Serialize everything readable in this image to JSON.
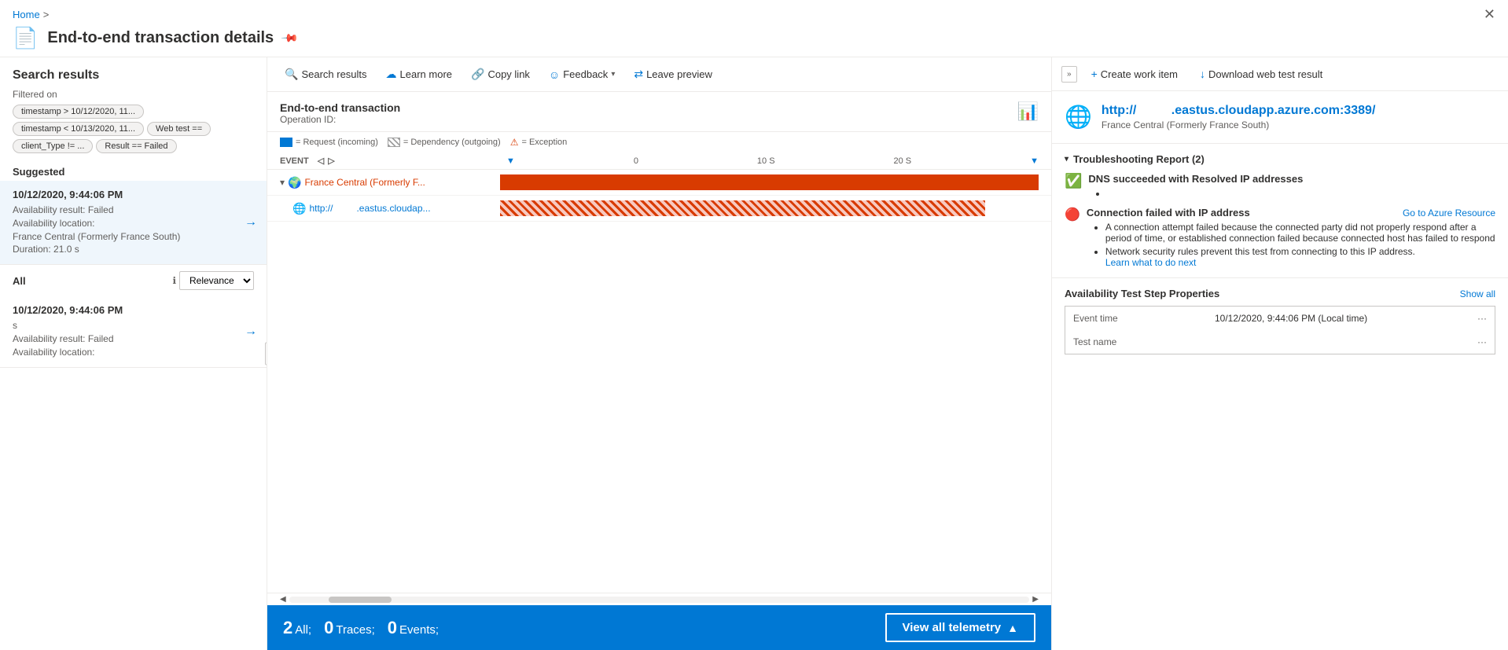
{
  "breadcrumb": {
    "home": "Home",
    "separator": ">"
  },
  "page": {
    "title": "End-to-end transaction details",
    "pin_label": "📌"
  },
  "left_panel": {
    "header": "Search results",
    "filter_label": "Filtered on",
    "filters": [
      "timestamp > 10/12/2020, 11...",
      "timestamp < 10/13/2020, 11...",
      "Web test ==",
      "client_Type !=  ...",
      "Result == Failed"
    ],
    "suggested_label": "Suggested",
    "results": [
      {
        "date": "10/12/2020, 9:44:06 PM",
        "details": "Availability result: Failed\nAvailability location:\nFrance Central (Formerly France South)\nDuration: 21.0 s",
        "selected": true
      }
    ],
    "sort_label": "All",
    "sort_options": [
      "Relevance"
    ],
    "sort_selected": "Relevance",
    "result2_date": "10/12/2020, 9:44:06 PM",
    "result2_detail": "s\nAvailability result: Failed\nAvailability location:"
  },
  "toolbar": {
    "search_results": "Search results",
    "learn_more": "Learn more",
    "copy_link": "Copy link",
    "feedback": "Feedback",
    "leave_preview": "Leave preview"
  },
  "transaction": {
    "title": "End-to-end transaction",
    "op_label": "Operation ID:",
    "legend": {
      "request_label": "= Request (incoming)",
      "dependency_label": "= Dependency (outgoing)",
      "exception_label": "= Exception"
    },
    "timeline": {
      "event_col": "EVENT",
      "time_markers": [
        "0",
        "10 S",
        "20 S"
      ],
      "rows": [
        {
          "name": "France Central (Formerly F...",
          "type": "solid",
          "bar_left": "0%",
          "bar_width": "100%",
          "icon": "🌍"
        },
        {
          "name": "http://                .eastus.cloudap...",
          "type": "hatched",
          "bar_left": "0%",
          "bar_width": "90%",
          "icon": "🌐"
        }
      ]
    },
    "footer": {
      "all_label": "All;",
      "all_count": "2",
      "traces_label": "Traces;",
      "traces_count": "0",
      "events_label": "Events;",
      "events_count": "0",
      "view_all": "View all telemetry"
    }
  },
  "right_panel": {
    "create_work_item": "Create work item",
    "download_web_test": "Download web test result",
    "resource": {
      "url_prefix": "http://",
      "url_suffix": ".eastus.cloudapp.azure.com:3389/",
      "location": "France Central (Formerly France South)"
    },
    "troubleshooting": {
      "title": "Troubleshooting Report (2)",
      "items": [
        {
          "status": "success",
          "title": "DNS succeeded with Resolved IP addresses",
          "bullets": [
            ""
          ]
        },
        {
          "status": "error",
          "title": "Connection failed with IP address",
          "link": "Go to Azure Resource",
          "bullets": [
            "A connection attempt failed because the connected party did not properly respond after a period of time, or established connection failed because connected host has failed to respond",
            "Network security rules prevent this test from connecting to this IP address."
          ],
          "sub_link": "Learn what to do next"
        }
      ]
    },
    "properties": {
      "title": "Availability Test Step Properties",
      "show_all": "Show all",
      "rows": [
        {
          "name": "Event time",
          "value": "10/12/2020, 9:44:06 PM (Local time)"
        },
        {
          "name": "Test name",
          "value": ""
        }
      ]
    }
  }
}
